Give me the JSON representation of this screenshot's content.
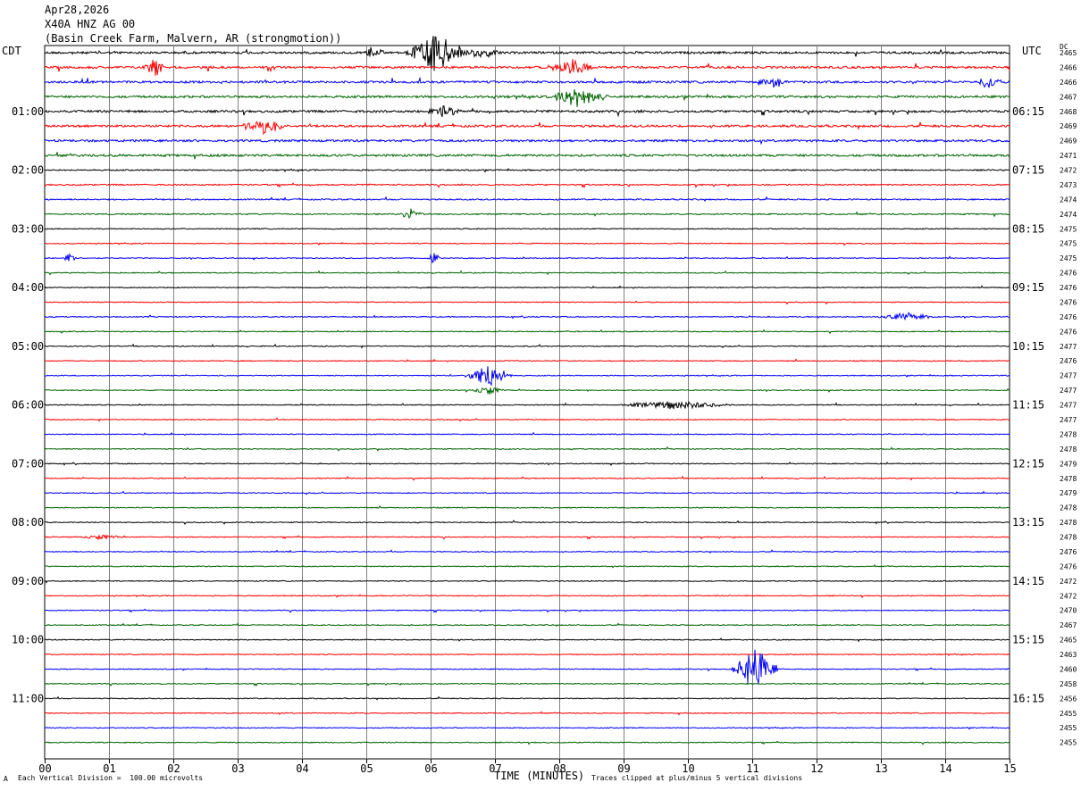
{
  "header": {
    "date": "Apr28,2026",
    "station": "X40A HNZ AG 00",
    "location": "(Basin Creek Farm, Malvern, AR (strongmotion))"
  },
  "left_timezone": "CDT",
  "right_timezone": "UTC",
  "dc_header": "DC",
  "footer": {
    "scale_note": "Each Vertical Division =  100.00 microvolts",
    "clip_note": "Traces clipped at plus/minus 5 vertical divisions",
    "x_axis_title": "TIME (MINUTES)",
    "corner_mark": "A"
  },
  "trace_colors": [
    "#000000",
    "#ff0000",
    "#0000ff",
    "#006400"
  ],
  "chart_data": {
    "type": "line",
    "title": "X40A HNZ AG 00",
    "xlabel": "TIME (MINUTES)",
    "xlim": [
      0,
      15
    ],
    "x_ticks": [
      "00",
      "01",
      "02",
      "03",
      "04",
      "05",
      "06",
      "07",
      "08",
      "09",
      "10",
      "11",
      "12",
      "13",
      "14",
      "15"
    ],
    "traces_per_hour": 4,
    "minutes_per_trace": 15,
    "left_time_labels": [
      "01:00",
      "02:00",
      "03:00",
      "04:00",
      "05:00",
      "06:00",
      "07:00",
      "08:00",
      "09:00",
      "10:00",
      "11:00"
    ],
    "right_time_labels": [
      "06:15",
      "07:15",
      "08:15",
      "09:15",
      "10:15",
      "11:15",
      "12:15",
      "13:15",
      "14:15",
      "15:15",
      "16:15"
    ],
    "dc_values": [
      "2465",
      "2466",
      "2466",
      "2467",
      "2468",
      "2469",
      "2469",
      "2471",
      "2472",
      "2473",
      "2474",
      "2474",
      "2475",
      "2475",
      "2475",
      "2476",
      "2476",
      "2476",
      "2476",
      "2476",
      "2477",
      "2476",
      "2477",
      "2477",
      "2477",
      "2477",
      "2478",
      "2478",
      "2479",
      "2478",
      "2479",
      "2478",
      "2478",
      "2478",
      "2476",
      "2476",
      "2472",
      "2472",
      "2470",
      "2467",
      "2465",
      "2463",
      "2460",
      "2458",
      "2456",
      "2455",
      "2455",
      "2455"
    ],
    "events": [
      {
        "trace": 0,
        "minute": 6.1,
        "amplitude": 5,
        "width": 0.5
      },
      {
        "trace": 0,
        "minute": 5.1,
        "amplitude": 1.5,
        "width": 0.2
      },
      {
        "trace": 0,
        "minute": 6.8,
        "amplitude": 1.5,
        "width": 0.3
      },
      {
        "trace": 1,
        "minute": 1.7,
        "amplitude": 2.5,
        "width": 0.2
      },
      {
        "trace": 1,
        "minute": 8.2,
        "amplitude": 2,
        "width": 0.4
      },
      {
        "trace": 2,
        "minute": 11.3,
        "amplitude": 1.5,
        "width": 0.3
      },
      {
        "trace": 2,
        "minute": 14.7,
        "amplitude": 2,
        "width": 0.2
      },
      {
        "trace": 3,
        "minute": 8.3,
        "amplitude": 2.5,
        "width": 0.5
      },
      {
        "trace": 4,
        "minute": 6.2,
        "amplitude": 1.5,
        "width": 0.3
      },
      {
        "trace": 5,
        "minute": 3.4,
        "amplitude": 2,
        "width": 0.4
      },
      {
        "trace": 11,
        "minute": 5.7,
        "amplitude": 1.5,
        "width": 0.2
      },
      {
        "trace": 14,
        "minute": 0.4,
        "amplitude": 2,
        "width": 0.1
      },
      {
        "trace": 14,
        "minute": 6.05,
        "amplitude": 1.5,
        "width": 0.1
      },
      {
        "trace": 18,
        "minute": 13.4,
        "amplitude": 1,
        "width": 0.5
      },
      {
        "trace": 22,
        "minute": 6.9,
        "amplitude": 3,
        "width": 0.4
      },
      {
        "trace": 23,
        "minute": 6.9,
        "amplitude": 1,
        "width": 0.3
      },
      {
        "trace": 24,
        "minute": 9.8,
        "amplitude": 1,
        "width": 1.0
      },
      {
        "trace": 33,
        "minute": 0.9,
        "amplitude": 0.6,
        "width": 0.4
      },
      {
        "trace": 42,
        "minute": 11.05,
        "amplitude": 5,
        "width": 0.4
      }
    ]
  }
}
